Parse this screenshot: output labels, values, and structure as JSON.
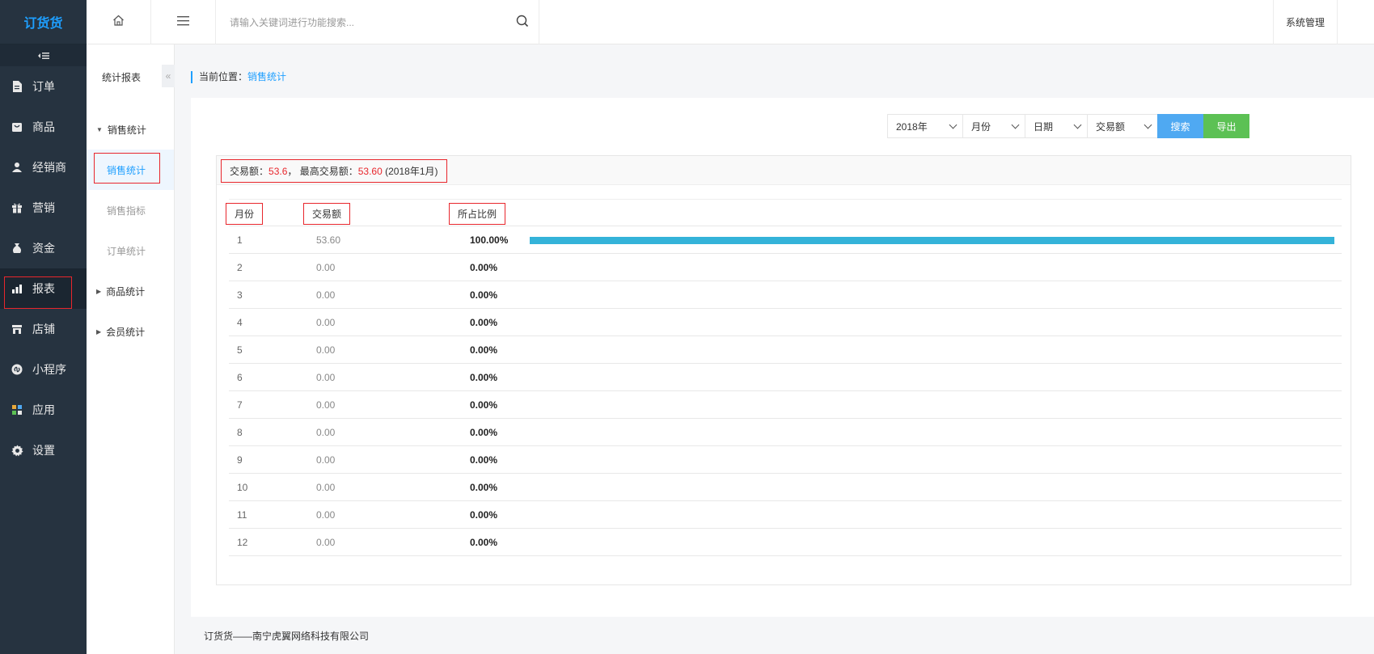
{
  "app": {
    "logo": "订货货"
  },
  "sidenav": {
    "items": [
      {
        "label": "订单",
        "icon": "document-icon"
      },
      {
        "label": "商品",
        "icon": "product-icon"
      },
      {
        "label": "经销商",
        "icon": "user-icon"
      },
      {
        "label": "营销",
        "icon": "gift-icon"
      },
      {
        "label": "资金",
        "icon": "money-bag-icon"
      },
      {
        "label": "报表",
        "icon": "chart-icon",
        "active": true
      },
      {
        "label": "店铺",
        "icon": "store-icon"
      },
      {
        "label": "小程序",
        "icon": "mini-program-icon"
      },
      {
        "label": "应用",
        "icon": "apps-icon"
      },
      {
        "label": "设置",
        "icon": "gear-icon"
      }
    ]
  },
  "subnav": {
    "title": "统计报表",
    "groups": [
      {
        "label": "销售统计",
        "expanded": true
      },
      {
        "label": "商品统计"
      },
      {
        "label": "会员统计"
      }
    ],
    "leaves": [
      "销售统计",
      "销售指标",
      "订单统计"
    ]
  },
  "topbar": {
    "search_placeholder": "请输入关键词进行功能搜索...",
    "sys_mgmt": "系统管理"
  },
  "breadcrumb": {
    "prefix": "当前位置：",
    "current": "销售统计"
  },
  "filters": {
    "year": "2018年",
    "period": "月份",
    "date": "日期",
    "metric": "交易额",
    "search_label": "搜索",
    "export_label": "导出"
  },
  "summary": {
    "amount_label": "交易额：",
    "amount": "53.6",
    "separator": "，",
    "max_label": "最高交易额：",
    "max_amount": "53.60",
    "max_period": "(2018年1月)"
  },
  "table": {
    "headers": [
      "月份",
      "交易额",
      "所占比例"
    ],
    "rows": [
      {
        "month": "1",
        "amount": "53.60",
        "pct": "100.00%",
        "ratio": 1.0
      },
      {
        "month": "2",
        "amount": "0.00",
        "pct": "0.00%",
        "ratio": 0
      },
      {
        "month": "3",
        "amount": "0.00",
        "pct": "0.00%",
        "ratio": 0
      },
      {
        "month": "4",
        "amount": "0.00",
        "pct": "0.00%",
        "ratio": 0
      },
      {
        "month": "5",
        "amount": "0.00",
        "pct": "0.00%",
        "ratio": 0
      },
      {
        "month": "6",
        "amount": "0.00",
        "pct": "0.00%",
        "ratio": 0
      },
      {
        "month": "7",
        "amount": "0.00",
        "pct": "0.00%",
        "ratio": 0
      },
      {
        "month": "8",
        "amount": "0.00",
        "pct": "0.00%",
        "ratio": 0
      },
      {
        "month": "9",
        "amount": "0.00",
        "pct": "0.00%",
        "ratio": 0
      },
      {
        "month": "10",
        "amount": "0.00",
        "pct": "0.00%",
        "ratio": 0
      },
      {
        "month": "11",
        "amount": "0.00",
        "pct": "0.00%",
        "ratio": 0
      },
      {
        "month": "12",
        "amount": "0.00",
        "pct": "0.00%",
        "ratio": 0
      }
    ]
  },
  "footer": {
    "text": "订货货——南宁虎翼网络科技有限公司"
  },
  "colors": {
    "accent": "#1e9fff",
    "bar": "#34b3d9",
    "highlight": "#e8262c",
    "sidebar": "#263340"
  }
}
